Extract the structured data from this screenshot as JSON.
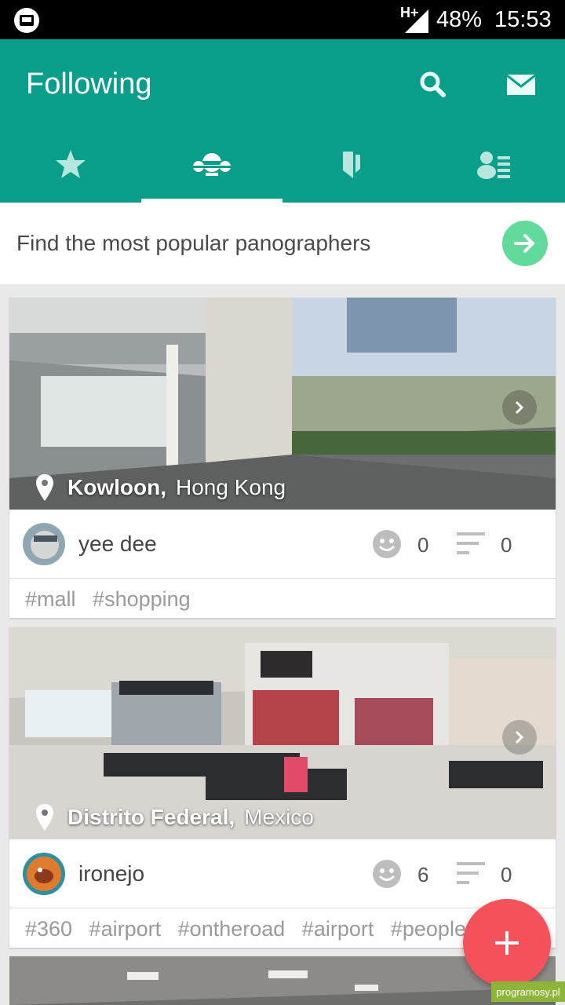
{
  "status_bar": {
    "network": "H+",
    "battery": "48%",
    "time": "15:53"
  },
  "app_bar": {
    "title": "Following",
    "icons": [
      "search-icon",
      "mail-icon"
    ]
  },
  "tabs": [
    {
      "icon": "star-icon",
      "active": false
    },
    {
      "icon": "panographers-icon",
      "active": true
    },
    {
      "icon": "bookmark-icon",
      "active": false
    },
    {
      "icon": "people-list-icon",
      "active": false
    }
  ],
  "find_bar": {
    "text": "Find the most popular panographers"
  },
  "feed": [
    {
      "location_city": "Kowloon,",
      "location_region": "Hong Kong",
      "user": "yee dee",
      "likes": "0",
      "comments": "0",
      "tags": [
        "#mall",
        "#shopping"
      ]
    },
    {
      "location_city": "Distrito Federal,",
      "location_region": "Mexico",
      "user": "ironejo",
      "likes": "6",
      "comments": "0",
      "tags": [
        "#360",
        "#airport",
        "#ontheroad",
        "#airport",
        "#people"
      ]
    }
  ],
  "fab": {
    "icon": "plus-icon"
  },
  "watermark": "programosy.pl",
  "colors": {
    "primary": "#089e8a",
    "accent": "#f5515a",
    "go_button": "#62da9c"
  }
}
